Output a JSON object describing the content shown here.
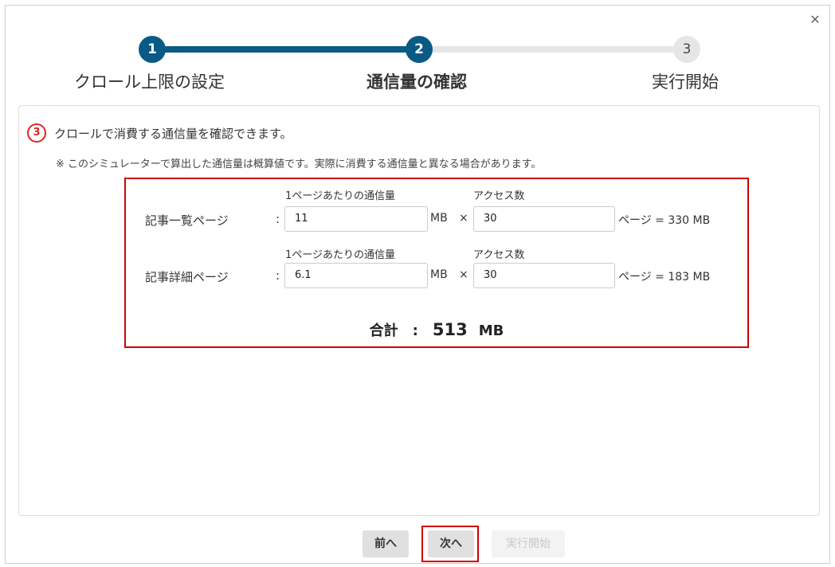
{
  "dialog": {
    "close_icon": "close-icon"
  },
  "stepper": {
    "steps": [
      {
        "number": "1",
        "label": "クロール上限の設定",
        "state": "done"
      },
      {
        "number": "2",
        "label": "通信量の確認",
        "state": "current"
      },
      {
        "number": "3",
        "label": "実行開始",
        "state": "todo"
      }
    ],
    "active_color": "#0a5a86"
  },
  "panel": {
    "step_marker": "③",
    "description": "クロールで消費する通信量を確認できます。",
    "note": "※ このシミュレーターで算出した通信量は概算値です。実際に消費する通信量と異なる場合があります。"
  },
  "calc": {
    "rows": [
      {
        "label": "記事一覧ページ",
        "colon": ":",
        "per_page_header": "1ページあたりの通信量",
        "per_page_value": "11",
        "unit": "MB",
        "times": "×",
        "access_header": "アクセス数",
        "access_value": "30",
        "result": "ページ = 330 MB"
      },
      {
        "label": "記事詳細ページ",
        "colon": ":",
        "per_page_header": "1ページあたりの通信量",
        "per_page_value": "6.1",
        "unit": "MB",
        "times": "×",
        "access_header": "アクセス数",
        "access_value": "30",
        "result": "ページ = 183 MB"
      }
    ],
    "total_label": "合計",
    "total_sep": ":",
    "total_value": "513",
    "total_unit": "MB",
    "highlight_color": "#d00000"
  },
  "footer": {
    "prev_label": "前へ",
    "next_label": "次へ",
    "run_label": "実行開始"
  }
}
